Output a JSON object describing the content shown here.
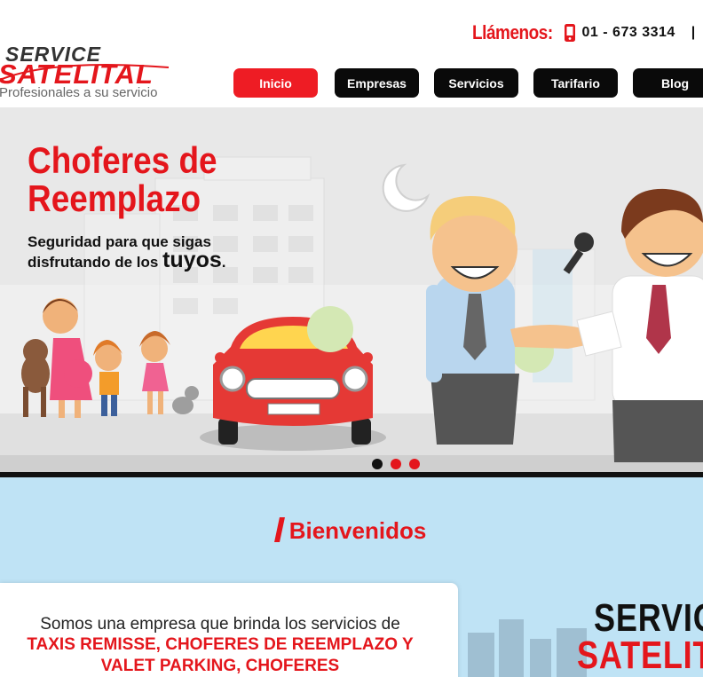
{
  "header": {
    "logo": {
      "word1": "SERVICE",
      "word2": "SATELITAL",
      "tagline": "Profesionales a su servicio"
    },
    "call": {
      "label": "Llámenos:",
      "icon": "mobile-phone-icon",
      "number": "01 - 673 3314",
      "separator": "|"
    },
    "nav": [
      {
        "label": "Inicio",
        "active": true
      },
      {
        "label": "Empresas",
        "active": false
      },
      {
        "label": "Servicios",
        "active": false
      },
      {
        "label": "Tarifario",
        "active": false
      },
      {
        "label": "Blog",
        "active": false
      }
    ]
  },
  "hero": {
    "title_line1": "Choferes de",
    "title_line2": "Reemplazo",
    "subtitle_line1": "Seguridad para que sigas",
    "subtitle_line2_prefix": "disfrutando de los",
    "subtitle_emphasis": "tuyos",
    "subtitle_end": ".",
    "slides": 3,
    "active_slide": 1
  },
  "welcome": {
    "title": "Bienvenidos",
    "text_line1": "Somos una empresa que brinda los servicios de",
    "text_line2": "TAXIS REMISSE, CHOFERES DE REEMPLAZO Y",
    "text_line3": "VALET PARKING, CHOFERES",
    "side_logo_word1": "SERVIC",
    "side_logo_word2": "SATELIT"
  },
  "colors": {
    "brand_red": "#e4161c",
    "nav_dark": "#0a0a0a",
    "welcome_bg": "#bfe3f5"
  }
}
